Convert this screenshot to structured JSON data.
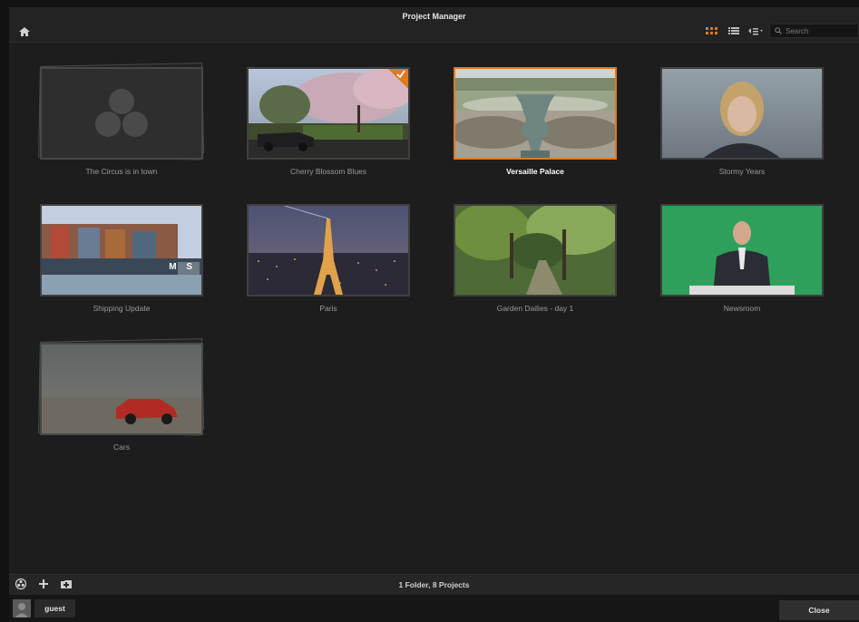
{
  "window": {
    "title": "Project Manager"
  },
  "toolbar": {
    "search_placeholder": "Search"
  },
  "projects": [
    {
      "name": "The Circus is in town",
      "type": "folder"
    },
    {
      "name": "Cherry Blossom Blues",
      "checked": true
    },
    {
      "name": "Versaille Palace",
      "selected": true
    },
    {
      "name": "Stormy Years"
    },
    {
      "name": "Shipping Update",
      "overlay": "M S"
    },
    {
      "name": "Paris"
    },
    {
      "name": "Garden Dailies - day 1"
    },
    {
      "name": "Newsroom"
    },
    {
      "name": "Cars",
      "stacked": true
    }
  ],
  "status": {
    "text": "1 Folder, 8 Projects"
  },
  "footer": {
    "user": "guest",
    "close_label": "Close"
  },
  "colors": {
    "accent": "#e07a1f"
  }
}
